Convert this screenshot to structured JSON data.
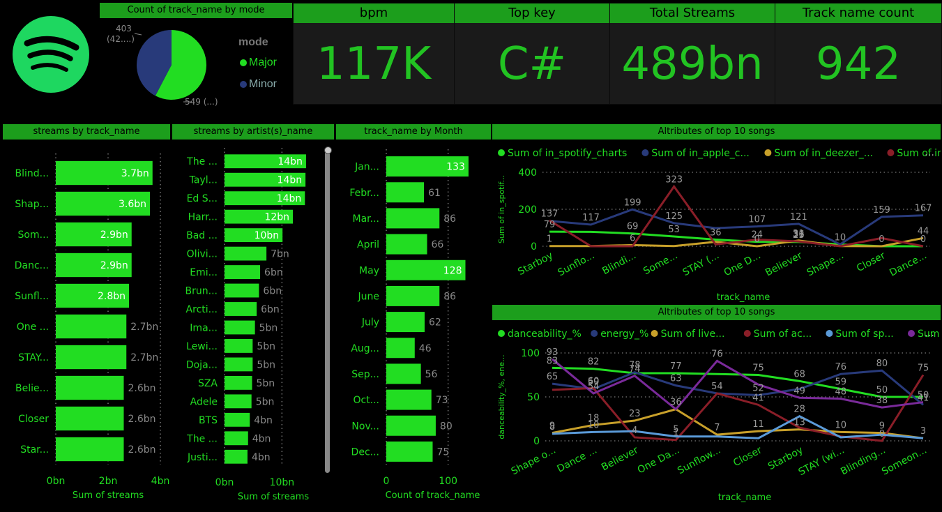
{
  "pie": {
    "title": "Count of track_name by mode",
    "legend_title": "mode",
    "slices": [
      {
        "name": "Major",
        "value": 549,
        "label": "549 (...)",
        "color": "#22dd22"
      },
      {
        "name": "Minor",
        "value": 403,
        "label": "403",
        "label2": "(42....)",
        "color": "#283a7a"
      }
    ]
  },
  "kpis": [
    {
      "title": "bpm",
      "value": "117K"
    },
    {
      "title": "Top key",
      "value": "C#"
    },
    {
      "title": "Total Streams",
      "value": "489bn"
    },
    {
      "title": "Track name count",
      "value": "942"
    }
  ],
  "chart_data": [
    {
      "id": "streams_track",
      "type": "bar",
      "title": "streams by track_name",
      "xlabel": "Sum of streams",
      "categories": [
        "Blind...",
        "Shap...",
        "Som...",
        "Danc...",
        "Sunfl...",
        "One ...",
        "STAY...",
        "Belie...",
        "Closer",
        "Star..."
      ],
      "values": [
        3.7,
        3.6,
        2.9,
        2.9,
        2.8,
        2.7,
        2.7,
        2.6,
        2.6,
        2.6
      ],
      "labels": [
        "3.7bn",
        "3.6bn",
        "2.9bn",
        "2.9bn",
        "2.8bn",
        "2.7bn",
        "2.7bn",
        "2.6bn",
        "2.6bn",
        "2.6bn"
      ],
      "ticks": [
        "0bn",
        "2bn",
        "4bn"
      ],
      "xlim": [
        0,
        4
      ]
    },
    {
      "id": "streams_artist",
      "type": "bar",
      "title": "streams by artist(s)_name",
      "xlabel": "Sum of streams",
      "categories": [
        "The ...",
        "Tayl...",
        "Ed S...",
        "Harr...",
        "Bad ...",
        "Olivi...",
        "Emi...",
        "Brun...",
        "Arcti...",
        "Ima...",
        "Lewi...",
        "Doja...",
        "SZA",
        "Adele",
        "BTS",
        "The ...",
        "Justi..."
      ],
      "values": [
        14.2,
        14.1,
        14.0,
        11.9,
        10.1,
        7.3,
        6.2,
        6.0,
        5.6,
        5.3,
        4.9,
        4.9,
        4.8,
        4.7,
        4.4,
        4.1,
        4.0
      ],
      "labels": [
        "14bn",
        "14bn",
        "14bn",
        "12bn",
        "10bn",
        "7bn",
        "6bn",
        "6bn",
        "6bn",
        "5bn",
        "5bn",
        "5bn",
        "5bn",
        "5bn",
        "4bn",
        "4bn",
        "4bn"
      ],
      "ticks": [
        "0bn",
        "10bn"
      ],
      "xlim": [
        0,
        17
      ]
    },
    {
      "id": "track_month",
      "type": "bar",
      "title": "track_name by Month",
      "xlabel": "Count of track_name",
      "categories": [
        "Jan...",
        "Febr...",
        "Mar...",
        "April",
        "May",
        "June",
        "July",
        "Aug...",
        "Sep...",
        "Oct...",
        "Nov...",
        "Dec..."
      ],
      "values": [
        133,
        61,
        86,
        66,
        128,
        86,
        62,
        46,
        56,
        73,
        80,
        75
      ],
      "labels": [
        "133",
        "61",
        "86",
        "66",
        "128",
        "86",
        "62",
        "46",
        "56",
        "73",
        "80",
        "75"
      ],
      "ticks": [
        "0",
        "100"
      ],
      "xlim": [
        0,
        150
      ]
    },
    {
      "id": "attr1",
      "type": "line",
      "title": "Altributes of top 10 songs",
      "xlabel": "track_name",
      "ylabel": "Sum of in_spotif...",
      "categories": [
        "Starboy",
        "Sunflo...",
        "Blindi...",
        "Some...",
        "STAY (...",
        "One D...",
        "Believer",
        "Shape...",
        "Closer",
        "Dance..."
      ],
      "ylim": [
        0,
        400
      ],
      "yticks": [
        "0",
        "200",
        "400"
      ],
      "series": [
        {
          "name": "Sum of in_spotify_charts",
          "color": "#22dd22",
          "values": [
            79,
            78,
            69,
            53,
            36,
            24,
            23,
            10,
            0,
            0
          ],
          "labels": [
            "79",
            "",
            "69",
            "53",
            "36",
            "24",
            "23",
            "",
            "",
            ""
          ]
        },
        {
          "name": "Sum of in_apple_c...",
          "color": "#283a7a",
          "values": [
            137,
            117,
            199,
            125,
            98,
            107,
            121,
            10,
            159,
            167
          ],
          "labels": [
            "137",
            "117",
            "199",
            "125",
            "",
            "107",
            "121",
            "10",
            "159",
            "167"
          ]
        },
        {
          "name": "Sum of in_deezer_...",
          "color": "#c8a02a",
          "values": [
            1,
            1,
            6,
            1,
            24,
            0,
            31,
            1,
            0,
            44
          ],
          "labels": [
            "1",
            "",
            "6",
            "",
            "",
            "0",
            "31",
            "",
            "0",
            "44"
          ]
        },
        {
          "name": "Sum of in_shaz...",
          "color": "#8a1e28",
          "values": [
            140,
            0,
            0,
            323,
            10,
            36,
            26,
            0,
            44,
            0
          ],
          "labels": [
            "",
            "",
            "",
            "323",
            "",
            "",
            "36",
            "",
            "",
            "0"
          ]
        }
      ]
    },
    {
      "id": "attr2",
      "type": "line",
      "title": "Altributes of top 10 songs",
      "xlabel": "track_name",
      "ylabel": "danceability_%, ene...",
      "categories": [
        "Shape o...",
        "Dance ...",
        "Believer",
        "One Da...",
        "Sunflow...",
        "Closer",
        "Starboy",
        "STAY (wi...",
        "Blinding...",
        "Someon..."
      ],
      "ylim": [
        0,
        100
      ],
      "yticks": [
        "0",
        "50",
        "100"
      ],
      "series": [
        {
          "name": "danceability_%",
          "color": "#22dd22",
          "values": [
            83,
            82,
            77,
            77,
            76,
            75,
            68,
            59,
            50,
            50
          ],
          "labels": [
            "83",
            "82",
            "",
            "77",
            "",
            "75",
            "68",
            "59",
            "50",
            ""
          ]
        },
        {
          "name": "energy_%",
          "color": "#283a7a",
          "values": [
            65,
            59,
            78,
            63,
            54,
            52,
            59,
            76,
            80,
            41
          ],
          "labels": [
            "65",
            "59",
            "78",
            "63",
            "54",
            "52",
            "",
            "76",
            "80",
            "41"
          ]
        },
        {
          "name": "Sum of live...",
          "color": "#c8a02a",
          "values": [
            9,
            18,
            23,
            36,
            7,
            11,
            13,
            10,
            9,
            3
          ],
          "labels": [
            "9",
            "18",
            "23",
            "36",
            "7",
            "11",
            "13",
            "10",
            "9",
            "3"
          ]
        },
        {
          "name": "Sum of ac...",
          "color": "#8a1e28",
          "values": [
            58,
            60,
            4,
            1,
            54,
            41,
            15,
            5,
            0,
            75
          ],
          "labels": [
            "",
            "60",
            "4",
            "1",
            "",
            "41",
            "",
            "",
            "0",
            "75"
          ]
        },
        {
          "name": "Sum of sp...",
          "color": "#5a9ad8",
          "values": [
            8,
            10,
            11,
            5,
            5,
            3,
            28,
            4,
            7,
            3
          ],
          "labels": [
            "8",
            "10",
            "",
            "5",
            "",
            "",
            "28",
            "",
            "",
            ""
          ]
        },
        {
          "name": "Sum of val...",
          "color": "#7a2a9a",
          "values": [
            93,
            54,
            74,
            36,
            91,
            64,
            49,
            48,
            38,
            44
          ],
          "labels": [
            "93",
            "54",
            "74",
            "",
            "76",
            "",
            "49",
            "48",
            "38",
            "50"
          ]
        }
      ]
    }
  ]
}
